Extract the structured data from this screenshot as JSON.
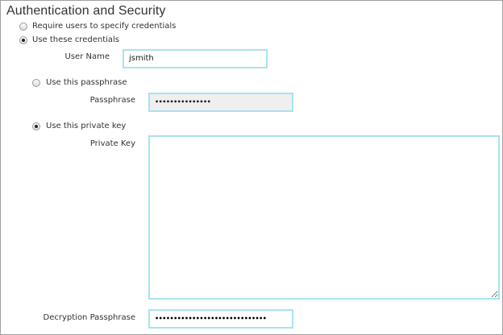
{
  "title": "Authentication and Security",
  "options": {
    "require_users": {
      "label": "Require users to specify credentials",
      "selected": false
    },
    "use_credentials": {
      "label": "Use these credentials",
      "selected": true
    }
  },
  "user_name": {
    "label": "User Name",
    "value": "jsmith"
  },
  "passphrase_option": {
    "label": "Use this passphrase",
    "selected": false
  },
  "passphrase": {
    "label": "Passphrase",
    "value": "•••••••••••••••"
  },
  "private_key_option": {
    "label": "Use this private key",
    "selected": true
  },
  "private_key": {
    "label": "Private Key",
    "value": ""
  },
  "decryption_passphrase": {
    "label": "Decryption Passphrase",
    "value": "••••••••••••••••••••••••••••••"
  },
  "colors": {
    "input_border": "#a6e4ef",
    "frame_border": "#a0a0a0",
    "disabled_bg": "#efefef"
  }
}
